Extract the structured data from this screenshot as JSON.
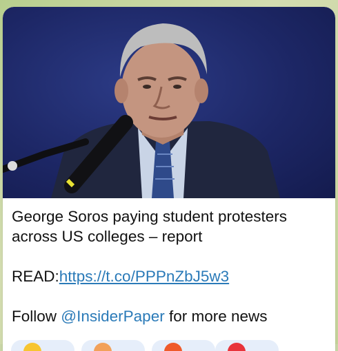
{
  "post": {
    "title_line1": "George Soros paying student protesters",
    "title_line2": "across US colleges – report",
    "read_label": "READ:",
    "read_link": "https://t.co/PPPnZbJ5w3",
    "follow_prefix": "Follow ",
    "follow_handle": "@InsiderPaper",
    "follow_suffix": " for more news"
  },
  "reactions": [
    {
      "icon": "thumbs-up-emoji",
      "color": "#f7c531"
    },
    {
      "icon": "shocked-face-emoji",
      "color": "#f2a15a"
    },
    {
      "icon": "fire-emoji",
      "color": "#ef5a2a"
    },
    {
      "icon": "heart-emoji",
      "color": "#e8343b"
    }
  ],
  "colors": {
    "link": "#2a7ab8",
    "bubble_bg": "#ffffff",
    "reaction_bg": "#e6eefa"
  }
}
